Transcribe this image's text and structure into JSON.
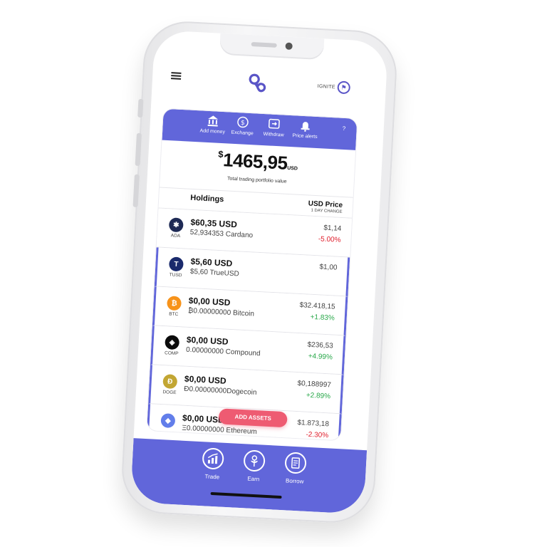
{
  "header": {
    "badge_text": "IGNITE",
    "logo_icon": "infinity-logo-icon",
    "menu_icon": "hamburger-menu-icon"
  },
  "actions": [
    {
      "label": "Add money",
      "icon": "bank-icon"
    },
    {
      "label": "Exchange",
      "icon": "exchange-icon"
    },
    {
      "label": "Withdraw",
      "icon": "withdraw-icon"
    },
    {
      "label": "Price alerts",
      "icon": "bell-icon"
    }
  ],
  "help_label": "?",
  "portfolio": {
    "currency_symbol": "$",
    "amount": "1465,95",
    "currency": "USD",
    "subtitle": "Total trading portfolio value"
  },
  "holdings_header": {
    "title": "Holdings",
    "price_title": "USD Price",
    "price_subtitle": "1 DAY CHANGE"
  },
  "holdings": [
    {
      "symbol": "ADA",
      "value": "$60,35 USD",
      "amount": "52,934353 Cardano",
      "price": "$1,14",
      "change": "-5.00%",
      "change_dir": "neg",
      "color": "#1e2a55",
      "glyph": "✱"
    },
    {
      "symbol": "TUSD",
      "value": "$5,60 USD",
      "amount": "$5,60 TrueUSD",
      "price": "$1,00",
      "change": "",
      "change_dir": "pos",
      "color": "#1a2a6c",
      "glyph": "T"
    },
    {
      "symbol": "BTC",
      "value": "$0,00 USD",
      "amount": "₿0.00000000 Bitcoin",
      "price": "$32.418,15",
      "change": "+1.83%",
      "change_dir": "pos",
      "color": "#f7931a",
      "glyph": "₿"
    },
    {
      "symbol": "COMP",
      "value": "$0,00 USD",
      "amount": "0.00000000 Compound",
      "price": "$236,53",
      "change": "+4.99%",
      "change_dir": "pos",
      "color": "#0b0b0b",
      "glyph": "◈"
    },
    {
      "symbol": "DOGE",
      "value": "$0,00 USD",
      "amount": "Ɖ0.00000000Dogecoin",
      "price": "$0,188997",
      "change": "+2.89%",
      "change_dir": "pos",
      "color": "#c2a633",
      "glyph": "Ð"
    },
    {
      "symbol": "ETH",
      "value": "$0,00 USD",
      "amount": "Ξ0.00000000 Ethereum",
      "price": "$1.873,18",
      "change": "-2.30%",
      "change_dir": "neg",
      "color": "#627eea",
      "glyph": "◆"
    }
  ],
  "add_assets_label": "ADD ASSETS",
  "bottom_nav": [
    {
      "label": "Trade",
      "icon": "trade-chart-icon"
    },
    {
      "label": "Earn",
      "icon": "earn-plant-icon"
    },
    {
      "label": "Borrow",
      "icon": "borrow-document-icon"
    }
  ],
  "colors": {
    "accent": "#6166da",
    "add_button": "#ee5b72",
    "negative": "#e0202e",
    "positive": "#29a84a"
  }
}
